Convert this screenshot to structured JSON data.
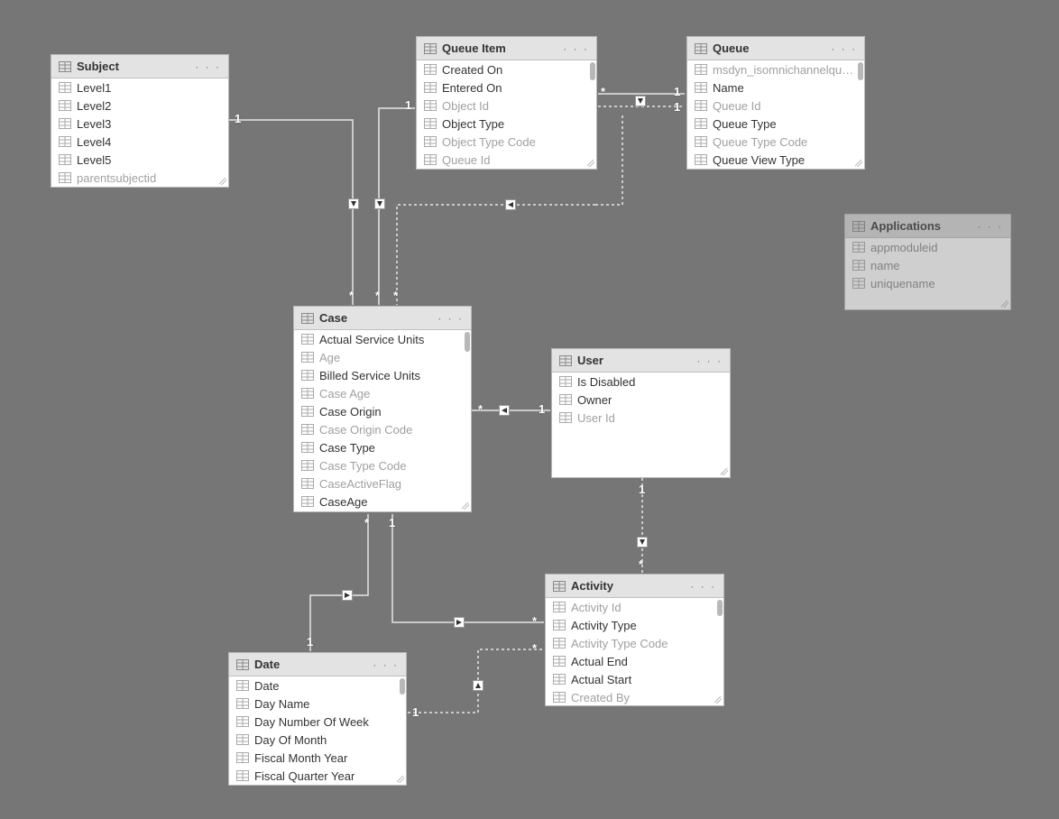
{
  "tables": {
    "subject": {
      "title": "Subject",
      "fields": [
        {
          "label": "Level1",
          "hidden": false
        },
        {
          "label": "Level2",
          "hidden": false
        },
        {
          "label": "Level3",
          "hidden": false
        },
        {
          "label": "Level4",
          "hidden": false
        },
        {
          "label": "Level5",
          "hidden": false
        },
        {
          "label": "parentsubjectid",
          "hidden": true
        }
      ]
    },
    "queueItem": {
      "title": "Queue Item",
      "fields": [
        {
          "label": "Created On",
          "hidden": false
        },
        {
          "label": "Entered On",
          "hidden": false
        },
        {
          "label": "Object Id",
          "hidden": true
        },
        {
          "label": "Object Type",
          "hidden": false
        },
        {
          "label": "Object Type Code",
          "hidden": true
        },
        {
          "label": "Queue Id",
          "hidden": true
        }
      ]
    },
    "queue": {
      "title": "Queue",
      "fields": [
        {
          "label": "msdyn_isomnichannelqueue",
          "hidden": true
        },
        {
          "label": "Name",
          "hidden": false
        },
        {
          "label": "Queue Id",
          "hidden": true
        },
        {
          "label": "Queue Type",
          "hidden": false
        },
        {
          "label": "Queue Type Code",
          "hidden": true
        },
        {
          "label": "Queue View Type",
          "hidden": false
        }
      ]
    },
    "case": {
      "title": "Case",
      "fields": [
        {
          "label": "Actual Service Units",
          "hidden": false
        },
        {
          "label": "Age",
          "hidden": true
        },
        {
          "label": "Billed Service Units",
          "hidden": false
        },
        {
          "label": "Case Age",
          "hidden": true
        },
        {
          "label": "Case Origin",
          "hidden": false
        },
        {
          "label": "Case Origin Code",
          "hidden": true
        },
        {
          "label": "Case Type",
          "hidden": false
        },
        {
          "label": "Case Type Code",
          "hidden": true
        },
        {
          "label": "CaseActiveFlag",
          "hidden": true
        },
        {
          "label": "CaseAge",
          "hidden": false
        }
      ]
    },
    "user": {
      "title": "User",
      "fields": [
        {
          "label": "Is Disabled",
          "hidden": false
        },
        {
          "label": "Owner",
          "hidden": false
        },
        {
          "label": "User Id",
          "hidden": true
        }
      ]
    },
    "applications": {
      "title": "Applications",
      "fields": [
        {
          "label": "appmoduleid",
          "hidden": true
        },
        {
          "label": "name",
          "hidden": true
        },
        {
          "label": "uniquename",
          "hidden": true
        }
      ]
    },
    "activity": {
      "title": "Activity",
      "fields": [
        {
          "label": "Activity Id",
          "hidden": true
        },
        {
          "label": "Activity Type",
          "hidden": false
        },
        {
          "label": "Activity Type Code",
          "hidden": true
        },
        {
          "label": "Actual End",
          "hidden": false
        },
        {
          "label": "Actual Start",
          "hidden": false
        },
        {
          "label": "Created By",
          "hidden": true
        }
      ]
    },
    "date": {
      "title": "Date",
      "fields": [
        {
          "label": "Date",
          "hidden": false
        },
        {
          "label": "Day Name",
          "hidden": false
        },
        {
          "label": "Day Number Of Week",
          "hidden": false
        },
        {
          "label": "Day Of Month",
          "hidden": false
        },
        {
          "label": "Fiscal Month Year",
          "hidden": false
        },
        {
          "label": "Fiscal Quarter Year",
          "hidden": false
        }
      ]
    }
  },
  "cardinality": {
    "one": "1",
    "many": "*"
  },
  "relationships": [
    {
      "from": "subject",
      "to": "case",
      "from_card": "1",
      "to_card": "*",
      "style": "solid"
    },
    {
      "from": "queueItem",
      "to": "case",
      "from_card": "1",
      "to_card": "*",
      "style": "solid",
      "note": "left"
    },
    {
      "from": "queueItem",
      "to": "case",
      "from_card": "",
      "to_card": "*",
      "style": "dashed",
      "note": "right"
    },
    {
      "from": "queueItem",
      "to": "queue",
      "from_card": "*",
      "to_card": "1",
      "style": "solid"
    },
    {
      "from": "queueItem",
      "to": "queue",
      "from_card": "",
      "to_card": "1",
      "style": "dashed"
    },
    {
      "from": "case",
      "to": "user",
      "from_card": "*",
      "to_card": "1",
      "style": "solid"
    },
    {
      "from": "case",
      "to": "activity",
      "from_card": "1",
      "to_card": "*",
      "style": "solid"
    },
    {
      "from": "case",
      "to": "date",
      "from_card": "*",
      "to_card": "1",
      "style": "solid"
    },
    {
      "from": "user",
      "to": "activity",
      "from_card": "1",
      "to_card": "*",
      "style": "dashed"
    },
    {
      "from": "date",
      "to": "activity",
      "from_card": "1",
      "to_card": "*",
      "style": "dashed"
    },
    {
      "from": "queue",
      "to": "case",
      "from_card": "1",
      "to_card": "*",
      "style": "dashed",
      "via": "queueItem"
    }
  ]
}
